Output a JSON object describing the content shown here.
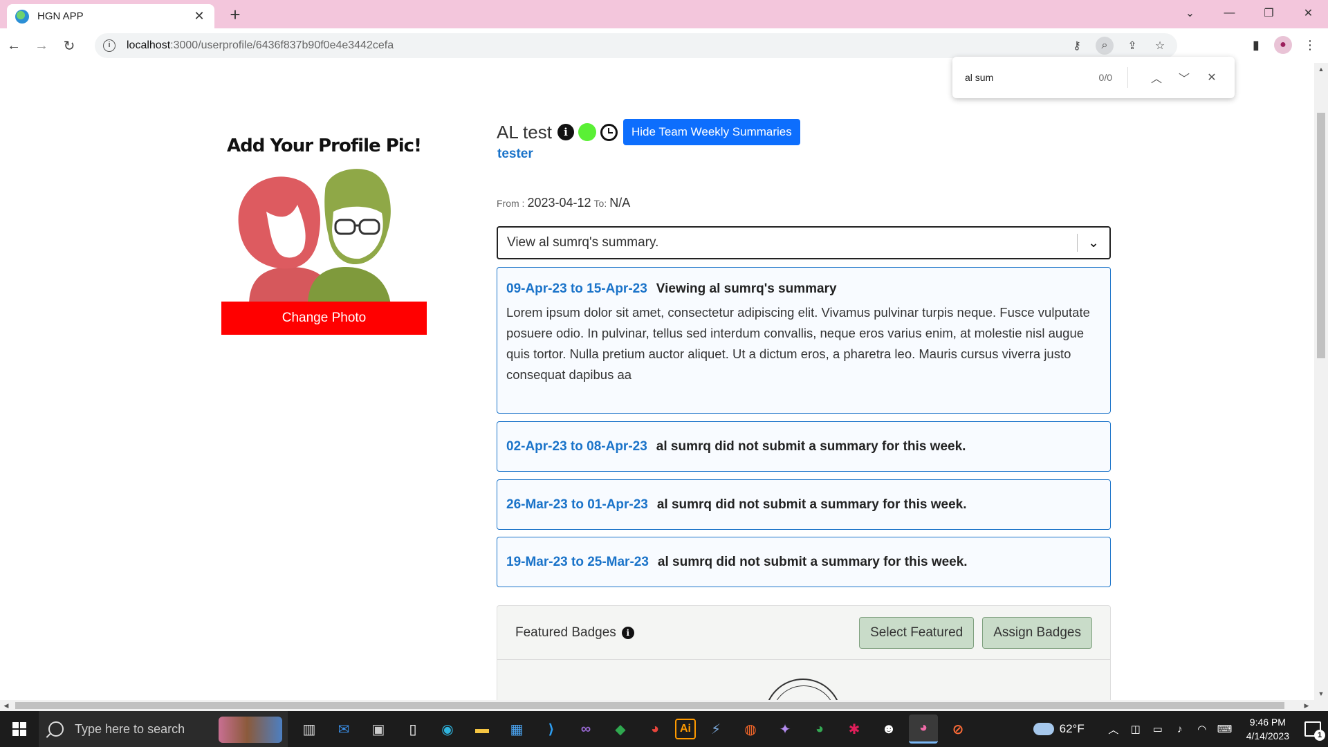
{
  "browser": {
    "tab_title": "HGN APP",
    "url_host": "localhost",
    "url_rest": ":3000/userprofile/6436f837b90f0e4e3442cefa"
  },
  "find_bar": {
    "query": "al sum",
    "count": "0/0"
  },
  "profile": {
    "pic_caption": "Add Your Profile Pic!",
    "change_photo_label": "Change Photo",
    "name": "AL test",
    "role": "tester",
    "hide_summaries_label": "Hide Team Weekly Summaries",
    "from_label": "From :",
    "from_date": "2023-04-12",
    "to_label": "To:",
    "to_date": "N/A",
    "status_color": "#5af035"
  },
  "summary_select": {
    "value": "View al sumrq's summary."
  },
  "summaries": [
    {
      "dates": "09-Apr-23 to 15-Apr-23",
      "message": "Viewing al sumrq's summary",
      "body": "Lorem ipsum dolor sit amet, consectetur adipiscing elit. Vivamus pulvinar turpis neque. Fusce vulputate posuere odio. In pulvinar, tellus sed interdum convallis, neque eros varius enim, at molestie nisl augue quis tortor. Nulla pretium auctor aliquet. Ut a dictum eros, a pharetra leo. Mauris cursus viverra justo consequat dapibus aa"
    },
    {
      "dates": "02-Apr-23 to 08-Apr-23",
      "message": "al sumrq did not submit a summary for this week."
    },
    {
      "dates": "26-Mar-23 to 01-Apr-23",
      "message": "al sumrq did not submit a summary for this week."
    },
    {
      "dates": "19-Mar-23 to 25-Mar-23",
      "message": "al sumrq did not submit a summary for this week."
    }
  ],
  "badges": {
    "title": "Featured Badges",
    "select_featured_label": "Select Featured",
    "assign_badges_label": "Assign Badges"
  },
  "taskbar": {
    "search_placeholder": "Type here to search",
    "weather": "62°F",
    "time": "9:46 PM",
    "date": "4/14/2023",
    "notifications": "1",
    "apps": [
      "task-view",
      "mail",
      "terminal",
      "file",
      "edge",
      "file-explorer",
      "store",
      "vscode",
      "visual-studio",
      "git",
      "chrome",
      "illustrator",
      "sql",
      "firefox",
      "tools",
      "chrome-alt",
      "slack",
      "penguin",
      "chrome-active",
      "postman"
    ]
  },
  "colors": {
    "accent_blue": "#0d6efd",
    "link_blue": "#1a73c9",
    "change_photo_red": "#ff0000",
    "tab_bar_pink": "#f3c6dc"
  }
}
